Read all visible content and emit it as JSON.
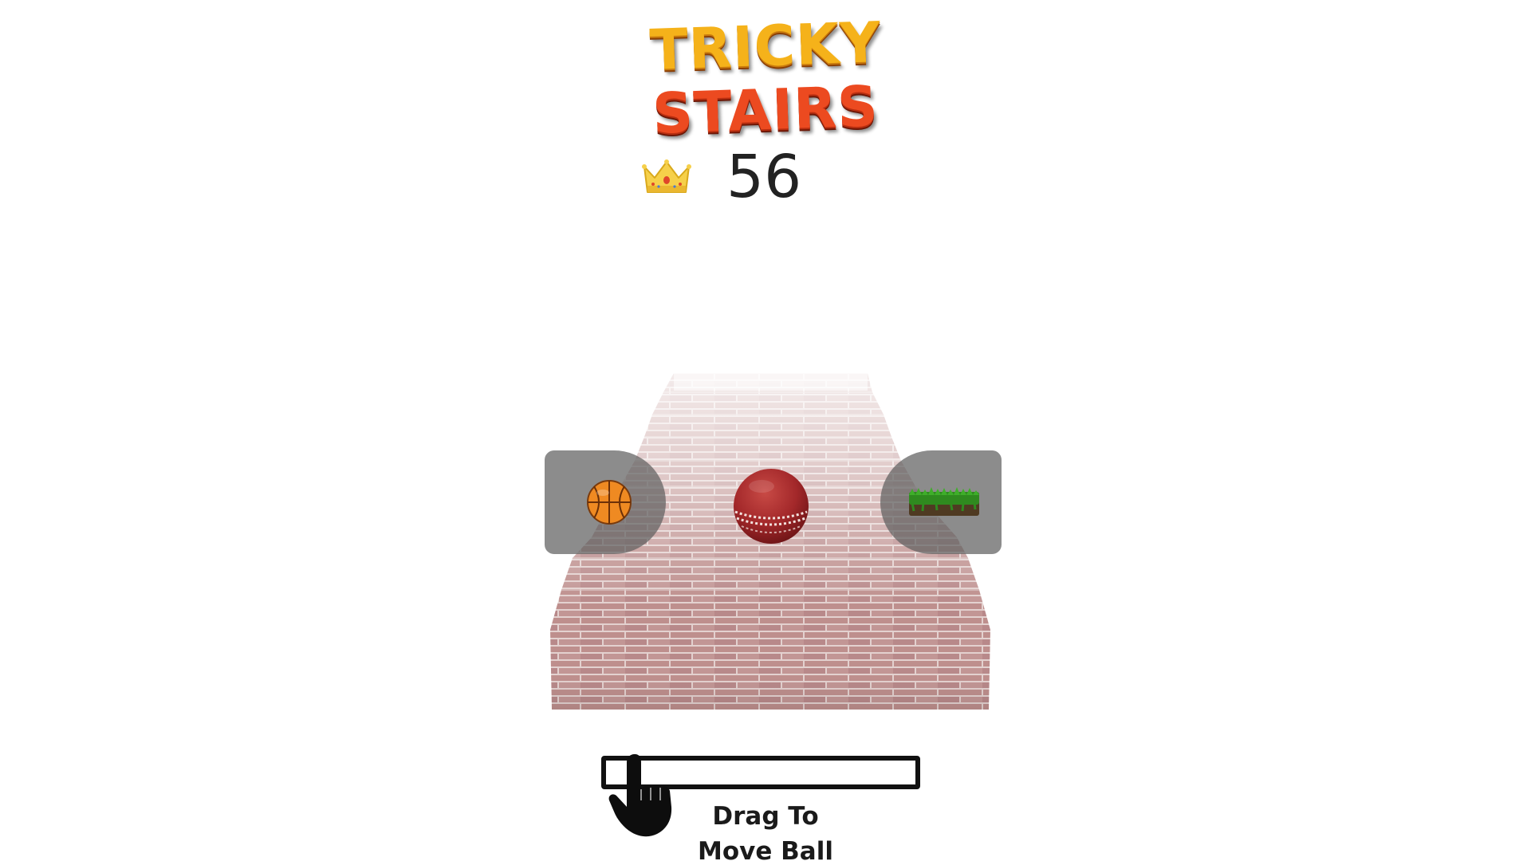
{
  "game": {
    "title_line_1": "TRICKY",
    "title_line_2": "STAIRS"
  },
  "best_score": {
    "icon": "crown-icon",
    "value": "56"
  },
  "ball_choices": {
    "left": {
      "icon": "basketball-icon"
    },
    "center": {
      "icon": "cricket-ball-icon"
    },
    "right": {
      "icon": "grass-block-icon"
    }
  },
  "tutorial": {
    "icon": "pointing-hand-icon",
    "line_1": "Drag To",
    "line_2": "Move Ball"
  },
  "colors": {
    "logo_top": "#f5b21a",
    "logo_bottom": "#ec4a20",
    "brick": "#b98886",
    "mortar": "#e6d4d2",
    "cricket_ball": "#a3282a"
  }
}
